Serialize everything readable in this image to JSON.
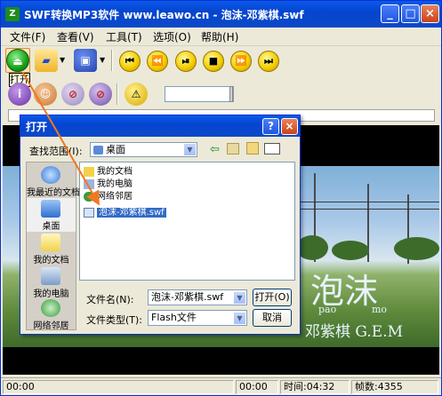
{
  "window": {
    "title": "SWF转换MP3软件 www.leawo.cn - 泡沫-邓紫棋.swf",
    "app_icon": "Z",
    "title_buttons": [
      "_",
      "□",
      "×"
    ]
  },
  "menu": [
    {
      "label": "文件(F)"
    },
    {
      "label": "查看(V)"
    },
    {
      "label": "工具(T)"
    },
    {
      "label": "选项(O)"
    },
    {
      "label": "帮助(H)"
    }
  ],
  "toolbar": {
    "open_tooltip": "打开",
    "buttons": [
      "eject-icon",
      "folder-open-icon",
      "save-icon",
      "skip-back-icon",
      "rewind-icon",
      "play-pause-icon",
      "stop-icon",
      "fast-forward-icon",
      "skip-forward-icon"
    ],
    "row2_buttons": [
      "info-icon",
      "user-icon",
      "video-disabled-icon",
      "no-access-icon",
      "warning-icon"
    ]
  },
  "video": {
    "overlay_title": "泡沫",
    "overlay_pinyin_1": "pao",
    "overlay_pinyin_2": "mo",
    "overlay_artist": "邓紫棋 G.E.M"
  },
  "status": {
    "left_time": "00:00",
    "mid_time": "00:00",
    "duration_label": "时间:04:32",
    "frames_label": "帧数:4355"
  },
  "dialog": {
    "title": "打开",
    "title_buttons": [
      "?",
      "×"
    ],
    "lookin_label": "查找范围(I):",
    "lookin_value": "桌面",
    "places": [
      {
        "label": "我最近的文档"
      },
      {
        "label": "桌面"
      },
      {
        "label": "我的文档"
      },
      {
        "label": "我的电脑"
      },
      {
        "label": "网络邻居"
      }
    ],
    "files": [
      {
        "name": "我的文档"
      },
      {
        "name": "我的电脑"
      },
      {
        "name": "网络邻居"
      },
      {
        "name": "泡沫-邓紫棋.swf"
      }
    ],
    "filename_label": "文件名(N):",
    "filename_value": "泡沫-邓紫棋.swf",
    "filetype_label": "文件类型(T):",
    "filetype_value": "Flash文件",
    "open_button": "打开(O)",
    "cancel_button": "取消"
  },
  "colors": {
    "titlebar": "#0a5ae8",
    "window_bg": "#ece9d8",
    "selection": "#316ac5",
    "arrow": "#f07820"
  }
}
